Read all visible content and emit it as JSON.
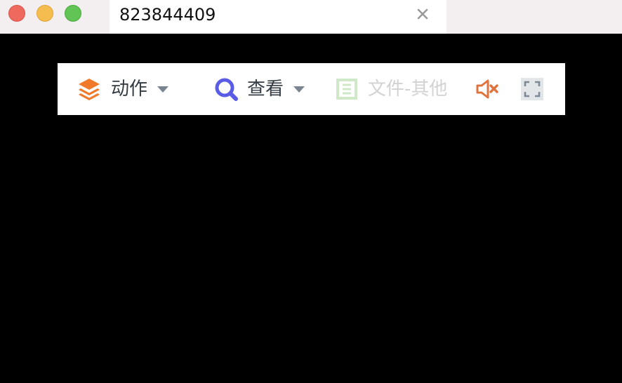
{
  "window": {
    "tab_title": "823844409"
  },
  "toolbar": {
    "action_label": "动作",
    "view_label": "查看",
    "file_other_label": "文件-其他"
  },
  "colors": {
    "action_icon": "#f07a2a",
    "view_icon": "#5b5ce6",
    "file_disabled": "#d2d2d2",
    "file_icon_disabled": "#cfe8c8",
    "mute_icon": "#e0733d",
    "label_text": "#333b44",
    "fullscreen_bg": "#e3e6e9",
    "fullscreen_icon": "#7d8a96"
  }
}
